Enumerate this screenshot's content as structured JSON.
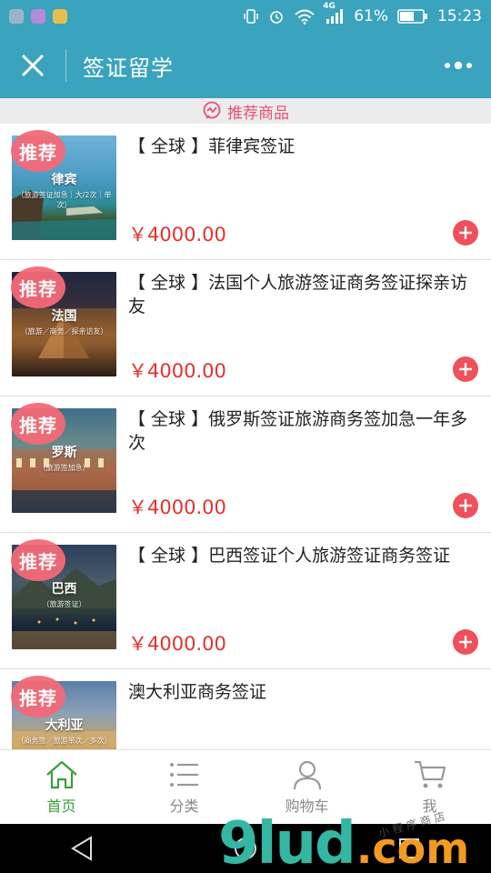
{
  "status_bar": {
    "network": "4G",
    "battery": "61%",
    "time": "15:23"
  },
  "title_bar": {
    "title": "签证留学"
  },
  "section": {
    "label": "推荐商品"
  },
  "badge_text": "推荐",
  "products": [
    {
      "title": "【 全球 】菲律宾签证",
      "price": "￥4000.00",
      "thumb_name": "律宾",
      "thumb_sub": "（旅游签证加急｜大/2次｜单次）"
    },
    {
      "title": "【 全球 】法国个人旅游签证商务签证探亲访友",
      "price": "￥4000.00",
      "thumb_name": "法国",
      "thumb_sub": "（旅游／商务／探亲访友）"
    },
    {
      "title": "【 全球 】俄罗斯签证旅游商务签加急一年多次",
      "price": "￥4000.00",
      "thumb_name": "罗斯",
      "thumb_sub": "（旅游签加急）"
    },
    {
      "title": "【 全球 】巴西签证个人旅游签证商务签证",
      "price": "￥4000.00",
      "thumb_name": "巴西",
      "thumb_sub": "（旅游签证）"
    },
    {
      "title": "澳大利亚商务签证",
      "price": "",
      "thumb_name": "大利亚",
      "thumb_sub": "（商务签／旅游单次／多次）"
    }
  ],
  "bottom_nav": [
    {
      "label": "首页",
      "icon": "home-icon",
      "active": true
    },
    {
      "label": "分类",
      "icon": "list-icon",
      "active": false
    },
    {
      "label": "购物车",
      "icon": "user-icon",
      "active": false
    },
    {
      "label": "我",
      "icon": "cart-icon",
      "active": false
    }
  ],
  "watermark": {
    "main": "9lud",
    "tld": ".com",
    "small": "小 程 序 商 店"
  },
  "colors": {
    "header": "#3aa3bd",
    "accent_pink": "#e94e77",
    "price_red": "#e4312e",
    "add_button": "#f0505a",
    "nav_active": "#3a9f3a"
  }
}
